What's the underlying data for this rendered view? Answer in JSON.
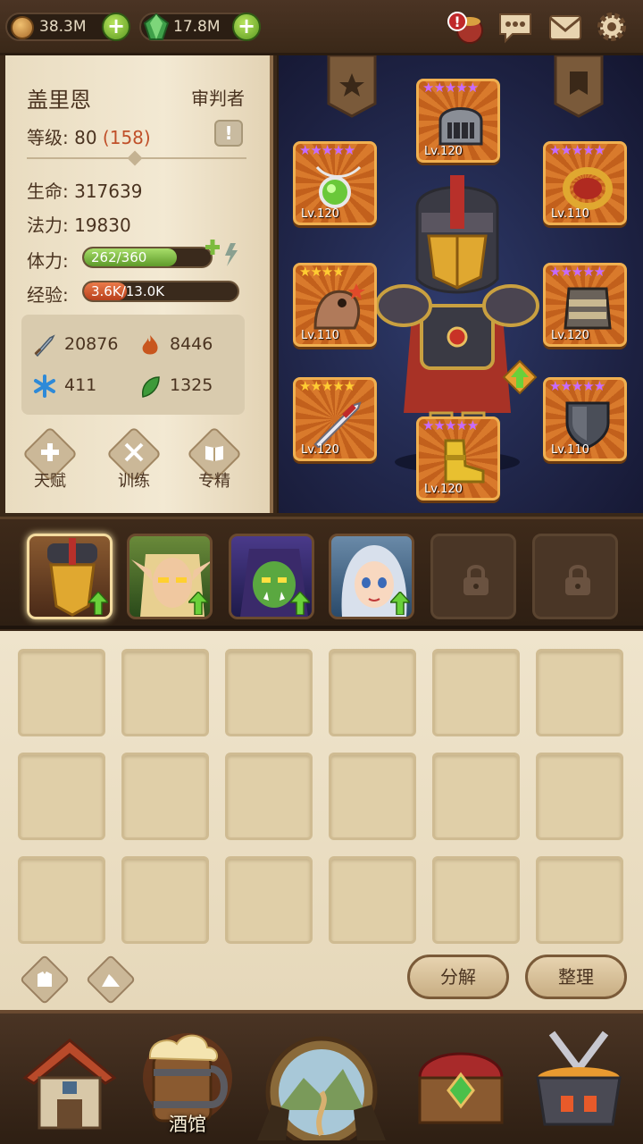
{
  "topbar": {
    "gold": "38.3M",
    "gems": "17.8M"
  },
  "hero": {
    "name": "盖里恩",
    "class": "审判者",
    "level_label": "等级:",
    "level": "80",
    "level_extra": "(158)",
    "hp_label": "生命:",
    "hp": "317639",
    "mp_label": "法力:",
    "mp": "19830",
    "stamina_label": "体力:",
    "stamina_text": "262/360",
    "stamina_fraction": 0.73,
    "exp_label": "经验:",
    "exp_text": "3.6K/13.0K",
    "exp_fraction": 0.28,
    "attributes": {
      "attack": "20876",
      "fire": "8446",
      "frost": "411",
      "nature": "1325"
    },
    "buttons": {
      "talent": "天赋",
      "training": "训练",
      "mastery": "专精"
    }
  },
  "equipment": {
    "helm": "Lv.120",
    "amulet": "Lv.120",
    "ring": "Lv.110",
    "shoulder": "Lv.110",
    "chest": "Lv.120",
    "weapon": "Lv.120",
    "offhand": "Lv.110",
    "boots": "Lv.120"
  },
  "inventory": {
    "decompose_label": "分解",
    "sort_label": "整理"
  },
  "nav": {
    "tavern_label": "酒馆"
  },
  "colors": {
    "stamina_bar": "#7dbb3e",
    "exp_bar": "#d0542a",
    "epic_star": "#c66bff",
    "legend_star": "#ffcc33"
  }
}
